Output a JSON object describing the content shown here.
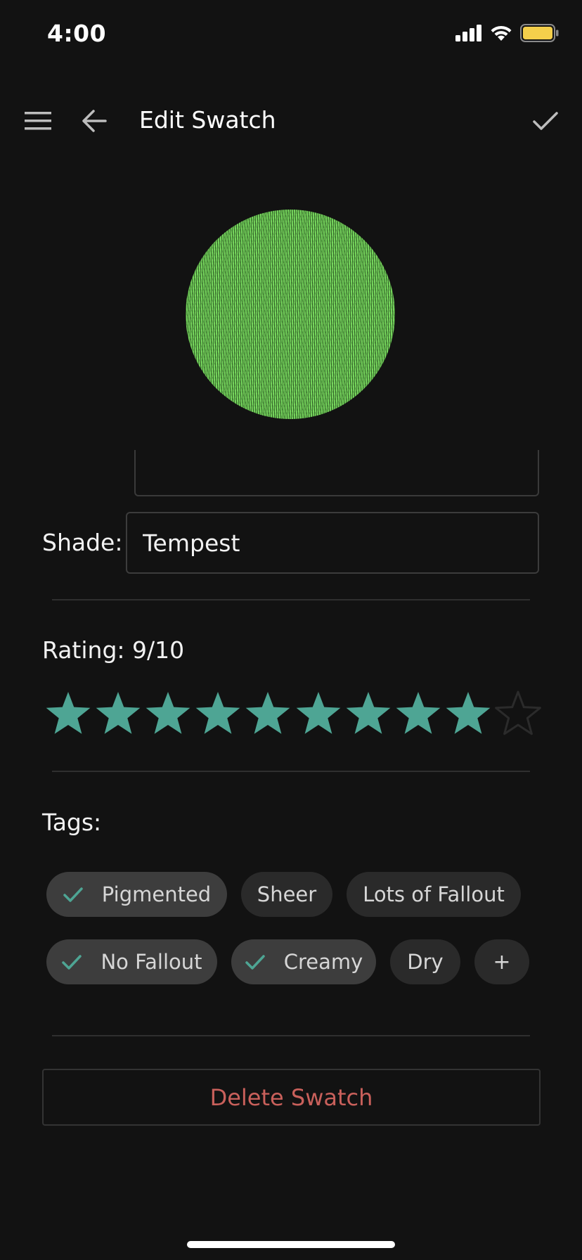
{
  "status_bar": {
    "time": "4:00",
    "icons": [
      "signal-icon",
      "wifi-icon",
      "battery-icon"
    ],
    "battery_color": "#f4cf4b"
  },
  "top_bar": {
    "title": "Edit Swatch",
    "menu_icon": "hamburger-menu-icon",
    "back_icon": "arrow-left-icon",
    "save_icon": "checkmark-icon"
  },
  "swatch": {
    "color": "#72d25a"
  },
  "shade": {
    "label": "Shade:",
    "value": "Tempest"
  },
  "rating": {
    "label": "Rating: 9/10",
    "value": 9,
    "max": 10,
    "filled_color": "#4ea594",
    "empty_color": "#2b2b2b"
  },
  "tags": {
    "label": "Tags:",
    "check_color": "#4ea594",
    "items": [
      {
        "label": "Pigmented",
        "selected": true
      },
      {
        "label": "Sheer",
        "selected": false
      },
      {
        "label": "Lots of Fallout",
        "selected": false
      },
      {
        "label": "No Fallout",
        "selected": true
      },
      {
        "label": "Creamy",
        "selected": true
      },
      {
        "label": "Dry",
        "selected": false
      }
    ],
    "add_label": "+"
  },
  "delete": {
    "label": "Delete Swatch",
    "color": "#c9605b"
  }
}
